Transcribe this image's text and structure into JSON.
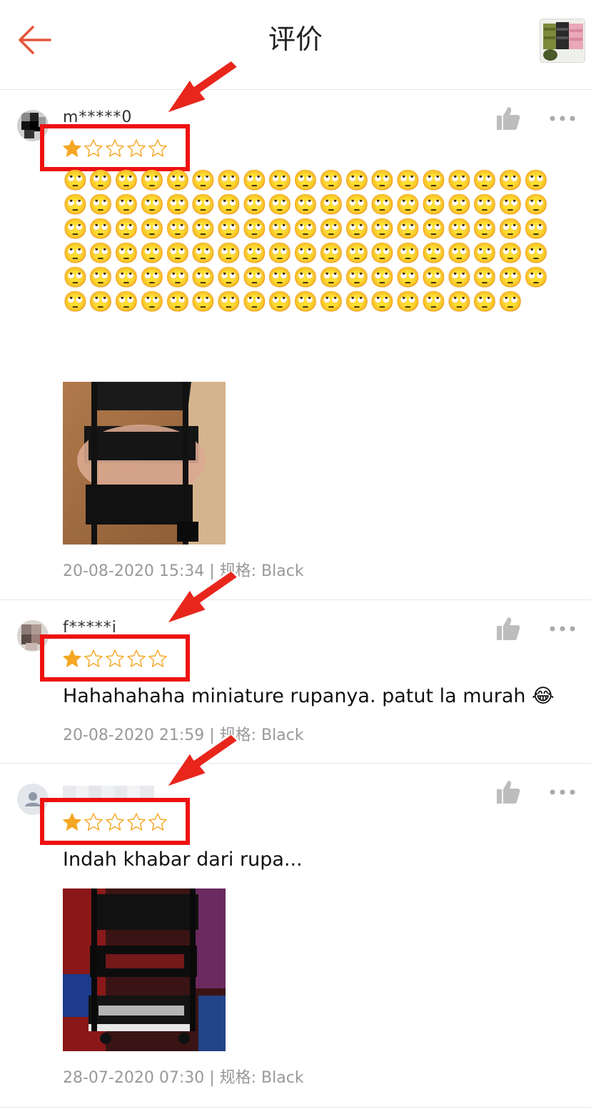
{
  "header": {
    "title": "评价",
    "back_icon": "arrow-left-icon",
    "accent": "#e4553a"
  },
  "reviews": [
    {
      "username": "m*****0",
      "rating": 1,
      "max_rating": 5,
      "text": "🙄🙄🙄🙄🙄🙄🙄🙄🙄🙄🙄🙄🙄🙄🙄🙄🙄🙄🙄🙄🙄🙄🙄🙄🙄🙄🙄🙄🙄🙄🙄🙄🙄🙄🙄🙄🙄🙄🙄🙄🙄🙄🙄🙄🙄🙄🙄🙄🙄🙄🙄🙄🙄🙄🙄🙄🙄🙄🙄🙄🙄🙄🙄🙄🙄🙄🙄🙄🙄🙄🙄🙄🙄🙄🙄🙄🙄🙄🙄🙄🙄🙄🙄🙄🙄🙄🙄🙄🙄🙄🙄🙄🙄🙄🙄🙄🙄🙄🙄🙄🙄🙄🙄🙄🙄🙄🙄🙄🙄🙄🙄🙄🙄",
      "meta": "20-08-2020 15:34 | 规格: Black",
      "has_photo": true
    },
    {
      "username": "f*****i",
      "rating": 1,
      "max_rating": 5,
      "text": "Hahahahaha miniature rupanya. patut la murah 😂",
      "meta": "20-08-2020 21:59 | 规格: Black",
      "has_photo": false
    },
    {
      "username": "",
      "rating": 1,
      "max_rating": 5,
      "text": "Indah khabar dari rupa...",
      "meta": "28-07-2020 07:30 | 规格: Black",
      "has_photo": true
    }
  ],
  "colors": {
    "star": "#f5a623",
    "highlight": "#ee1111",
    "meta_text": "#999999"
  }
}
